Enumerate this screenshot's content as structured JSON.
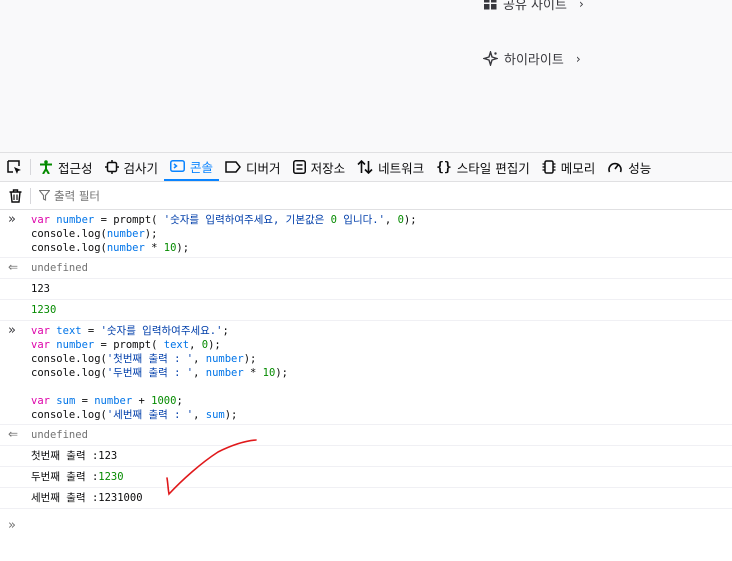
{
  "page": {
    "links": [
      {
        "label": "공유 사이트",
        "icon": "grid-icon"
      },
      {
        "label": "하이라이트",
        "icon": "sparkle-icon"
      }
    ]
  },
  "devtools": {
    "tabs": [
      {
        "label": "접근성",
        "icon": "accessibility-icon"
      },
      {
        "label": "검사기",
        "icon": "inspector-icon"
      },
      {
        "label": "콘솔",
        "icon": "console-icon",
        "active": true
      },
      {
        "label": "디버거",
        "icon": "debugger-icon"
      },
      {
        "label": "저장소",
        "icon": "storage-icon"
      },
      {
        "label": "네트워크",
        "icon": "network-icon"
      },
      {
        "label": "스타일 편집기",
        "icon": "braces-icon"
      },
      {
        "label": "메모리",
        "icon": "memory-icon"
      },
      {
        "label": "성능",
        "icon": "performance-icon"
      }
    ],
    "filter_placeholder": "출력 필터",
    "accent_color": "#0a84ff"
  },
  "console": {
    "entries": [
      {
        "type": "input",
        "lines": [
          "var number = prompt( '숫자를 입력하여주세요, 기본값은 0 입니다.', 0);",
          "console.log(number);",
          "console.log(number * 10);"
        ]
      },
      {
        "type": "result",
        "text": "undefined"
      },
      {
        "type": "log",
        "text": "123"
      },
      {
        "type": "log-number",
        "text": "1230"
      },
      {
        "type": "input",
        "lines": [
          "var text = '숫자를 입력하여주세요.';",
          "var number = prompt( text, 0);",
          "console.log('첫번째 출력 : ', number);",
          "console.log('두번째 출력 : ', number * 10);",
          "",
          "var sum = number + 1000;",
          "console.log('세번째 출력 : ', sum);"
        ]
      },
      {
        "type": "result",
        "text": "undefined"
      },
      {
        "type": "log",
        "label": "첫번째 출력 :",
        "value": "123"
      },
      {
        "type": "log",
        "label": "두번째 출력 :",
        "value": "1230",
        "value_color": "#058b00"
      },
      {
        "type": "log",
        "label": "세번째 출력 :",
        "value": "1231000"
      }
    ]
  },
  "annotation": {
    "color": "#e0191b",
    "shape": "hand-drawn checkmark"
  }
}
